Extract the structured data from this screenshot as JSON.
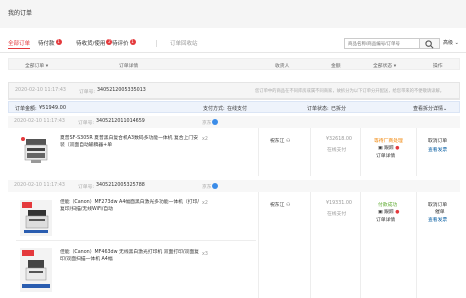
{
  "page_title": "我的订单",
  "tabs": [
    {
      "label": "全部订单",
      "badge": ""
    },
    {
      "label": "待付款",
      "badge": "1"
    },
    {
      "label": "待收货/使用",
      "badge": "2"
    },
    {
      "label": "待评价",
      "badge": "1"
    }
  ],
  "recycle_label": "订单回收站",
  "search": {
    "placeholder": "商品名称/商品编号/订单号",
    "advanced_label": "高级"
  },
  "table_headers": {
    "all_orders": "全部订单",
    "details": "订单详情",
    "consignee": "收货人",
    "amount": "金额",
    "status": "全部状态",
    "actions": "操作"
  },
  "order1": {
    "time": "2020-02-10 11:17:43",
    "order_no_label": "订单号:",
    "order_no": "3405212005335013",
    "notice": "您订单中的商品在不同库房或属不同商家，故拆分为以下订单分开配送，给您带来的不便敬请谅解。"
  },
  "order_summary": {
    "amount_label": "订单金额:",
    "amount": "¥51949.00",
    "pay_label": "支付方式:",
    "pay_method": "在线支付",
    "status_label": "订单状态:",
    "status": "已拆分",
    "detail_link": "查看拆分详情"
  },
  "sub1": {
    "time": "2020-02-10 11:17:43",
    "order_no_label": "订单号:",
    "order_no": "3405212011014659",
    "shop": "京东",
    "product_title": "夏普SF-S305R 夏普黑白复合机A3数码多功能一体机 复合上门安装（双面自动输稿器+单",
    "qty": "x2",
    "consignee": "祝东江",
    "amount": "¥32618.00",
    "pay": "在线支付",
    "status": "等待厂商处理",
    "track": "跟踪",
    "detail": "订单详情",
    "action1": "取消订单",
    "action2": "查看发票"
  },
  "sub2": {
    "time": "2020-02-10 11:17:43",
    "order_no_label": "订单号:",
    "order_no": "3405212005325788",
    "shop": "京东",
    "product1_title": "佳能（Canon）MF273dw A4幅面黑白激光多功能一体机（打印/复印/扫描/无线WiFi/自动",
    "product1_qty": "x2",
    "product2_title": "佳能（Canon）MF463dw 无线黑白激光打印机 双面打印/双面复印/双面扫描一体机 A4幅",
    "product2_qty": "x3",
    "consignee": "祝东江",
    "amount": "¥19331.00",
    "pay": "在线支付",
    "status": "付款成功",
    "track": "跟踪",
    "detail": "订单详情",
    "action1": "取消订单",
    "action2": "催单",
    "action3": "查看发票"
  },
  "colors": {
    "accent": "#e4393c",
    "link": "#005aa0",
    "status_orange": "#f08200",
    "status_green": "#5aa92b"
  }
}
